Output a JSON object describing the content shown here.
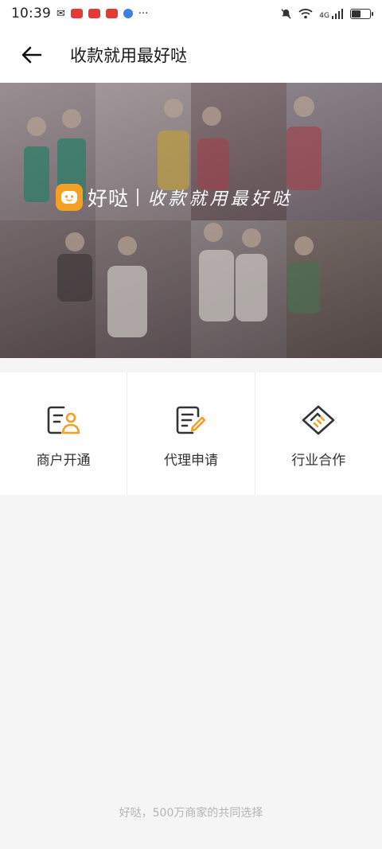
{
  "status_bar": {
    "time": "10:39",
    "network": "4G",
    "icons": [
      "mute-icon",
      "wifi-icon",
      "signal-icon",
      "battery-icon"
    ]
  },
  "header": {
    "back_icon": "arrow-left-icon",
    "title": "收款就用最好哒"
  },
  "banner": {
    "brand_name": "好哒",
    "slogan": "收款就用最好哒"
  },
  "menu": {
    "items": [
      {
        "label": "商户开通",
        "icon": "merchant-card-icon"
      },
      {
        "label": "代理申请",
        "icon": "document-edit-icon"
      },
      {
        "label": "行业合作",
        "icon": "handshake-icon"
      }
    ]
  },
  "footer": {
    "text": "好哒，500万商家的共同选择"
  },
  "colors": {
    "accent": "#f5a024",
    "icon_dark": "#333333",
    "background": "#f5f5f5"
  }
}
